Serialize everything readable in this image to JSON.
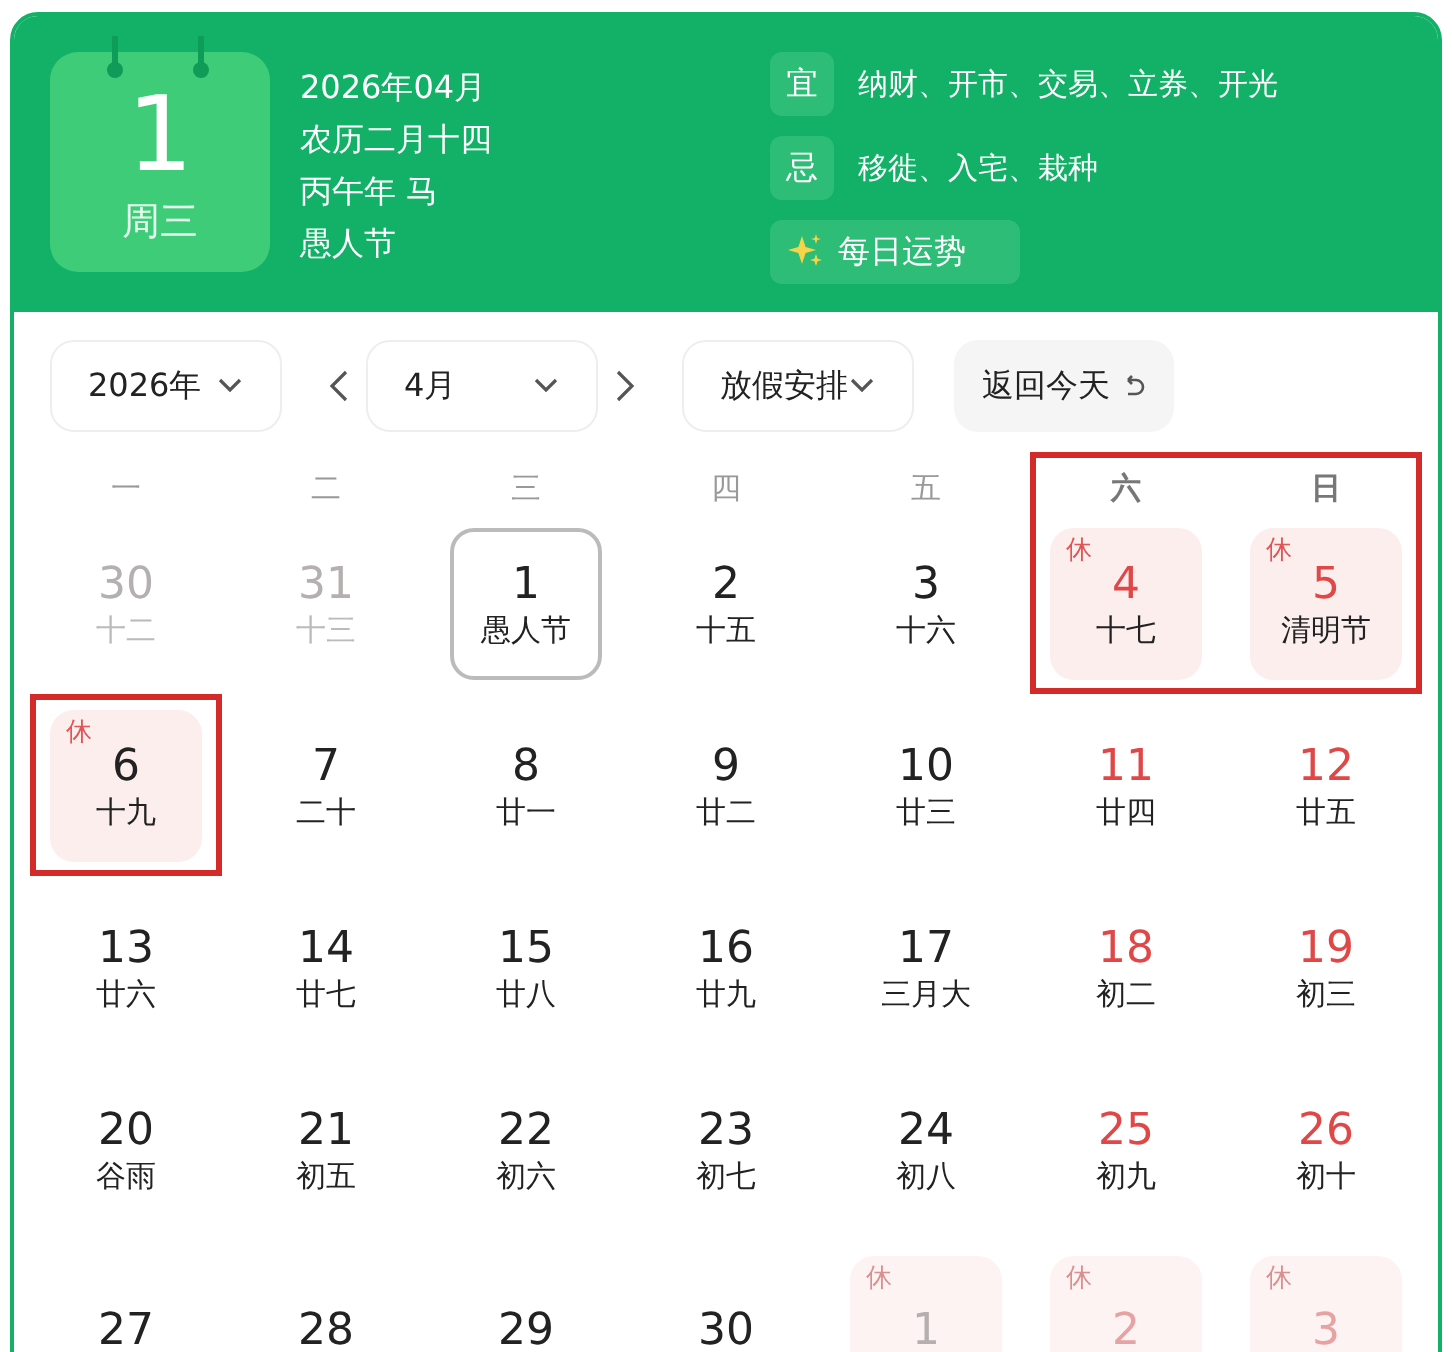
{
  "header": {
    "day": "1",
    "weekday": "周三",
    "info": [
      "2026年04月",
      "农历二月十四",
      "丙午年 马",
      "愚人节"
    ],
    "almanac": [
      {
        "label": "宜",
        "text": "纳财、开市、交易、立券、开光"
      },
      {
        "label": "忌",
        "text": "移徙、入宅、栽种"
      }
    ],
    "fortune_button": "每日运势"
  },
  "controls": {
    "year": "2026年",
    "month": "4月",
    "holiday_select": "放假安排",
    "today_button": "返回今天"
  },
  "weekdays": [
    {
      "label": "一",
      "weekend": false,
      "framed": false
    },
    {
      "label": "二",
      "weekend": false,
      "framed": false
    },
    {
      "label": "三",
      "weekend": false,
      "framed": false
    },
    {
      "label": "四",
      "weekend": false,
      "framed": false
    },
    {
      "label": "五",
      "weekend": false,
      "framed": false
    },
    {
      "label": "六",
      "weekend": true,
      "framed": true
    },
    {
      "label": "日",
      "weekend": true,
      "framed": true
    }
  ],
  "weeks": [
    [
      {
        "day": "30",
        "lunar": "十二",
        "other_month": true,
        "weekend": false,
        "today": false,
        "framed": false
      },
      {
        "day": "31",
        "lunar": "十三",
        "other_month": true,
        "weekend": false,
        "today": false,
        "framed": false
      },
      {
        "day": "1",
        "lunar": "愚人节",
        "other_month": false,
        "weekend": false,
        "today": true,
        "framed": false
      },
      {
        "day": "2",
        "lunar": "十五",
        "other_month": false,
        "weekend": false,
        "today": false,
        "framed": false
      },
      {
        "day": "3",
        "lunar": "十六",
        "other_month": false,
        "weekend": false,
        "today": false,
        "framed": false
      },
      {
        "day": "4",
        "lunar": "十七",
        "rest_mark": "休",
        "other_month": false,
        "weekend": true,
        "today": false,
        "framed": true
      },
      {
        "day": "5",
        "lunar": "清明节",
        "rest_mark": "休",
        "other_month": false,
        "weekend": true,
        "today": false,
        "framed": true
      }
    ],
    [
      {
        "day": "6",
        "lunar": "十九",
        "rest_mark": "休",
        "other_month": false,
        "weekend": false,
        "today": false,
        "framed": true
      },
      {
        "day": "7",
        "lunar": "二十",
        "other_month": false,
        "weekend": false,
        "today": false,
        "framed": false
      },
      {
        "day": "8",
        "lunar": "廿一",
        "other_month": false,
        "weekend": false,
        "today": false,
        "framed": false
      },
      {
        "day": "9",
        "lunar": "廿二",
        "other_month": false,
        "weekend": false,
        "today": false,
        "framed": false
      },
      {
        "day": "10",
        "lunar": "廿三",
        "other_month": false,
        "weekend": false,
        "today": false,
        "framed": false
      },
      {
        "day": "11",
        "lunar": "廿四",
        "other_month": false,
        "weekend": true,
        "today": false,
        "framed": false
      },
      {
        "day": "12",
        "lunar": "廿五",
        "other_month": false,
        "weekend": true,
        "today": false,
        "framed": false
      }
    ],
    [
      {
        "day": "13",
        "lunar": "廿六",
        "other_month": false,
        "weekend": false,
        "today": false,
        "framed": false
      },
      {
        "day": "14",
        "lunar": "廿七",
        "other_month": false,
        "weekend": false,
        "today": false,
        "framed": false
      },
      {
        "day": "15",
        "lunar": "廿八",
        "other_month": false,
        "weekend": false,
        "today": false,
        "framed": false
      },
      {
        "day": "16",
        "lunar": "廿九",
        "other_month": false,
        "weekend": false,
        "today": false,
        "framed": false
      },
      {
        "day": "17",
        "lunar": "三月大",
        "other_month": false,
        "weekend": false,
        "today": false,
        "framed": false
      },
      {
        "day": "18",
        "lunar": "初二",
        "other_month": false,
        "weekend": true,
        "today": false,
        "framed": false
      },
      {
        "day": "19",
        "lunar": "初三",
        "other_month": false,
        "weekend": true,
        "today": false,
        "framed": false
      }
    ],
    [
      {
        "day": "20",
        "lunar": "谷雨",
        "other_month": false,
        "weekend": false,
        "today": false,
        "framed": false
      },
      {
        "day": "21",
        "lunar": "初五",
        "other_month": false,
        "weekend": false,
        "today": false,
        "framed": false
      },
      {
        "day": "22",
        "lunar": "初六",
        "other_month": false,
        "weekend": false,
        "today": false,
        "framed": false
      },
      {
        "day": "23",
        "lunar": "初七",
        "other_month": false,
        "weekend": false,
        "today": false,
        "framed": false
      },
      {
        "day": "24",
        "lunar": "初八",
        "other_month": false,
        "weekend": false,
        "today": false,
        "framed": false
      },
      {
        "day": "25",
        "lunar": "初九",
        "other_month": false,
        "weekend": true,
        "today": false,
        "framed": false
      },
      {
        "day": "26",
        "lunar": "初十",
        "other_month": false,
        "weekend": true,
        "today": false,
        "framed": false
      }
    ],
    [
      {
        "day": "27",
        "other_month": false,
        "weekend": false,
        "today": false,
        "framed": false
      },
      {
        "day": "28",
        "other_month": false,
        "weekend": false,
        "today": false,
        "framed": false
      },
      {
        "day": "29",
        "other_month": false,
        "weekend": false,
        "today": false,
        "framed": false
      },
      {
        "day": "30",
        "other_month": false,
        "weekend": false,
        "today": false,
        "framed": false
      },
      {
        "day": "1",
        "rest_mark": "休",
        "other_month": true,
        "weekend": false,
        "today": false,
        "framed": false
      },
      {
        "day": "2",
        "rest_mark": "休",
        "other_month": true,
        "weekend": true,
        "today": false,
        "framed": false
      },
      {
        "day": "3",
        "rest_mark": "休",
        "other_month": true,
        "weekend": true,
        "today": false,
        "framed": false
      }
    ]
  ]
}
